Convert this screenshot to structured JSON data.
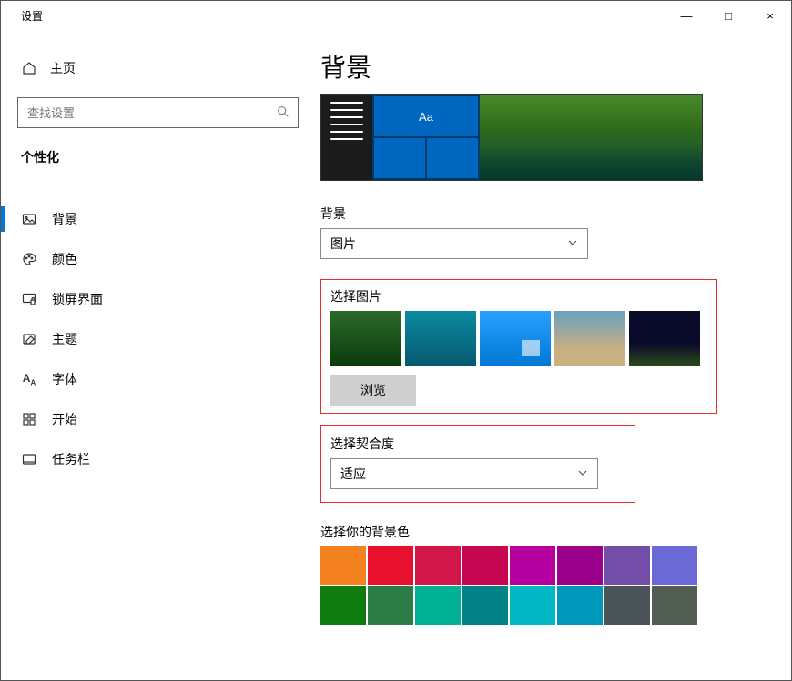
{
  "window": {
    "title": "设置",
    "controls": {
      "minimize": "—",
      "maximize": "□",
      "close": "×"
    }
  },
  "sidebar": {
    "home_label": "主页",
    "search_placeholder": "查找设置",
    "category_label": "个性化",
    "items": [
      {
        "label": "背景",
        "icon": "picture-icon",
        "active": true
      },
      {
        "label": "颜色",
        "icon": "palette-icon"
      },
      {
        "label": "锁屏界面",
        "icon": "lock-screen-icon"
      },
      {
        "label": "主题",
        "icon": "theme-icon"
      },
      {
        "label": "字体",
        "icon": "font-icon"
      },
      {
        "label": "开始",
        "icon": "start-icon"
      },
      {
        "label": "任务栏",
        "icon": "taskbar-icon"
      }
    ]
  },
  "main": {
    "page_title": "背景",
    "preview_tile_text": "Aa",
    "background_section_label": "背景",
    "background_select_value": "图片",
    "choose_picture_label": "选择图片",
    "browse_button_label": "浏览",
    "fit_label": "选择契合度",
    "fit_select_value": "适应",
    "choose_color_label": "选择你的背景色",
    "colors_row1": [
      "#f58220",
      "#e8112d",
      "#d1174a",
      "#c60651",
      "#b4009e",
      "#9a0089",
      "#744da9",
      "#6b69d6"
    ],
    "colors_row2": [
      "#107c10",
      "#2d7d46",
      "#00b294",
      "#038387",
      "#00b7c3",
      "#0099bc",
      "#4a5459",
      "#525e54"
    ]
  }
}
